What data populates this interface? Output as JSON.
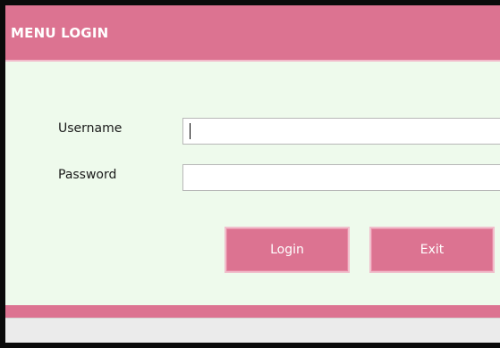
{
  "window": {
    "title": "MENU LOGIN"
  },
  "form": {
    "username_label": "Username",
    "username_value": "",
    "password_label": "Password",
    "password_value": ""
  },
  "buttons": {
    "login_label": "Login",
    "exit_label": "Exit"
  },
  "colors": {
    "accent": "#dc7391",
    "background": "#eefaec",
    "frame": "#0a0a0a",
    "status_bar": "#ebebeb"
  }
}
